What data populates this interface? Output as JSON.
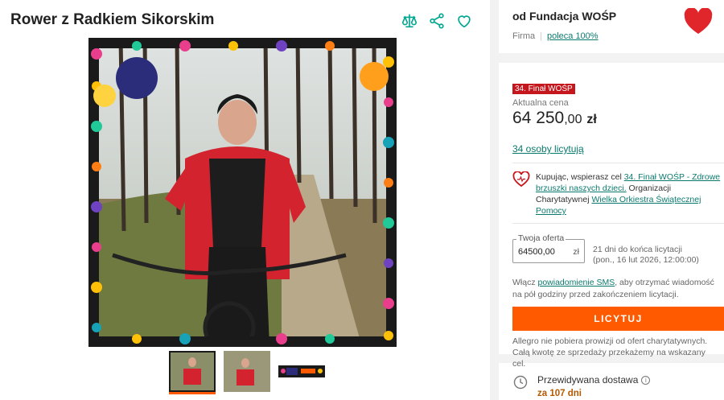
{
  "product": {
    "title": "Rower z Radkiem Sikorskim",
    "thumbnails": [
      {
        "name": "thumb-1",
        "active": true
      },
      {
        "name": "thumb-2",
        "active": false
      },
      {
        "name": "thumb-3",
        "active": false
      }
    ]
  },
  "actions": {
    "compare_icon": "scales-icon",
    "share_icon": "share-icon",
    "favorite_icon": "heart-icon"
  },
  "seller": {
    "name": "od Fundacja WOŚP",
    "type": "Firma",
    "recommend": "poleca 100%"
  },
  "offer": {
    "badge": "34. Finał WOŚP",
    "price_label": "Aktualna cena",
    "price_int": "64 250",
    "price_dec": ",00",
    "currency": "zł",
    "bidders": "34 osoby licytują",
    "charity": {
      "text1": "Kupując, wspierasz cel ",
      "goal_link": "34. Finał WOŚP - Zdrowe brzuszki naszych dzieci.",
      "text2": " Organizacji Charytatywnej ",
      "org_link": "Wielka Orkiestra Świątecznej Pomocy"
    },
    "bid": {
      "legend": "Twoja oferta",
      "value": "64500,00",
      "unit": "zł",
      "time_left": "21 dni do końca licytacji",
      "end_date": "(pon., 16 lut 2026, 12:00:00)"
    },
    "sms": {
      "prefix": "Włącz ",
      "link": "powiadomienie SMS",
      "suffix": ", aby otrzymać wiadomość na pół godziny przed zakończeniem licytacji."
    },
    "button_label": "LICYTUJ",
    "note": "Allegro nie pobiera prowizji od ofert charytatywnych. Całą kwotę ze sprzedaży przekażemy na wskazany cel."
  },
  "delivery": {
    "label": "Przewidywana dostawa",
    "value": "za 107 dni"
  },
  "colors": {
    "accent": "#ff5a00",
    "link": "#0b7a6e",
    "badge": "#c4161c",
    "icon": "#00a790"
  }
}
